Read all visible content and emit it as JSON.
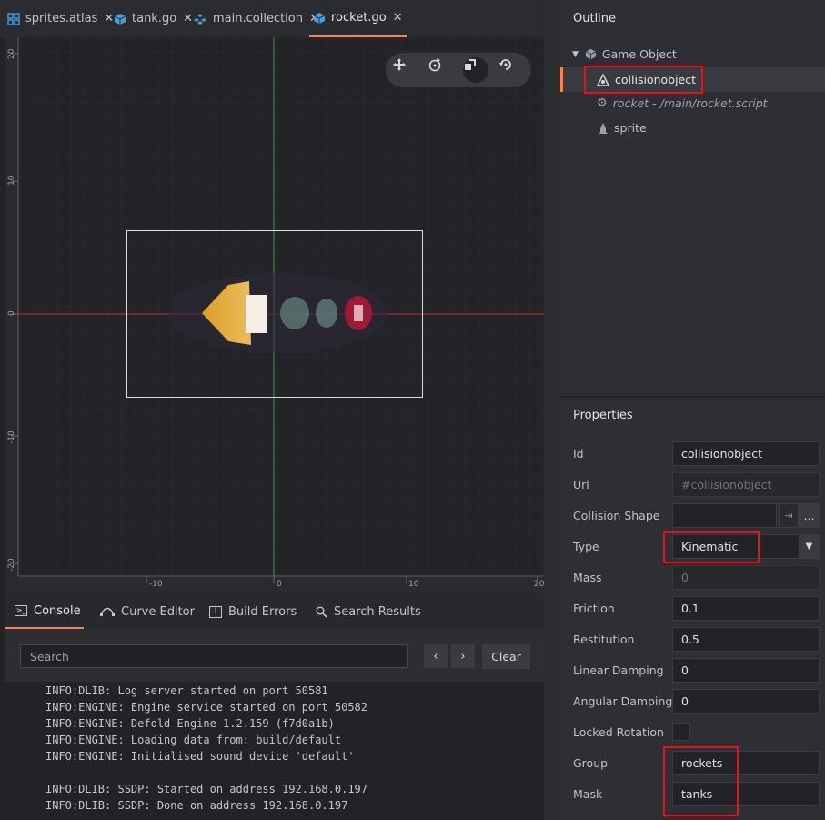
{
  "tabs": [
    {
      "label": "sprites.atlas",
      "icon": "atlas-icon"
    },
    {
      "label": "tank.go",
      "icon": "game-object-icon"
    },
    {
      "label": "main.collection",
      "icon": "collection-icon"
    },
    {
      "label": "rocket.go",
      "icon": "game-object-icon",
      "active": true
    }
  ],
  "viewport": {
    "y_ticks": [
      "20",
      "10",
      "0",
      "-10",
      "-20"
    ],
    "x_ticks": [
      "-10",
      "0",
      "10",
      "20"
    ],
    "toolbar": [
      "move-tool-icon",
      "rotate-tool-icon",
      "scale-tool-icon",
      "camera-reset-icon"
    ]
  },
  "console": {
    "tabs": [
      "Console",
      "Curve Editor",
      "Build Errors",
      "Search Results"
    ],
    "search_placeholder": "Search",
    "clear_label": "Clear",
    "prev_glyph": "‹",
    "next_glyph": "›",
    "lines": [
      "INFO:DLIB: Log server started on port 50581",
      "INFO:ENGINE: Engine service started on port 50582",
      "INFO:ENGINE: Defold Engine 1.2.159 (f7d0a1b)",
      "INFO:ENGINE: Loading data from: build/default",
      "INFO:ENGINE: Initialised sound device 'default'",
      "",
      "INFO:DLIB: SSDP: Started on address 192.168.0.197",
      "INFO:DLIB: SSDP: Done on address 192.168.0.197"
    ]
  },
  "outline": {
    "title": "Outline",
    "root": "Game Object",
    "items": [
      "collisionobject",
      "rocket - /main/rocket.script",
      "sprite"
    ]
  },
  "properties": {
    "title": "Properties",
    "id_label": "Id",
    "id_value": "collisionobject",
    "url_label": "Url",
    "url_value": "#collisionobject",
    "shape_label": "Collision Shape",
    "shape_browse": "…",
    "type_label": "Type",
    "type_value": "Kinematic",
    "mass_label": "Mass",
    "mass_value": "0",
    "friction_label": "Friction",
    "friction_value": "0.1",
    "restitution_label": "Restitution",
    "restitution_value": "0.5",
    "linear_label": "Linear Damping",
    "linear_value": "0",
    "angular_label": "Angular Damping",
    "angular_value": "0",
    "locked_label": "Locked Rotation",
    "locked_value": false,
    "group_label": "Group",
    "group_value": "rockets",
    "mask_label": "Mask",
    "mask_value": "tanks"
  },
  "colors": {
    "accent": "#ff7f4f",
    "highlight": "#e8101b",
    "x_axis": "#c03030",
    "y_axis": "#3f9a3f"
  }
}
